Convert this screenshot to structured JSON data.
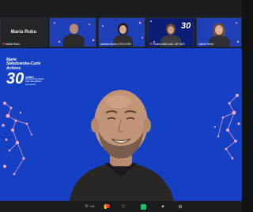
{
  "participants": [
    {
      "name": "Maria Rubu",
      "muted": true,
      "video": false
    },
    {
      "name": "",
      "muted": false,
      "video": true
    },
    {
      "name": "Adriana Bobu | GFCS.RO",
      "muted": false,
      "video": true
    },
    {
      "name": "Rodica Iulia Coin, GE SAS",
      "muted": true,
      "video": true
    },
    {
      "name": "Oana Ponea",
      "muted": false,
      "video": true
    }
  ],
  "main_speaker": {
    "name": ""
  },
  "branding": {
    "line1": "Marie",
    "line2": "Skłodowska-Curie",
    "line3": "Actions",
    "number": "30",
    "years": "years",
    "tagline1": "Connecting ideas",
    "tagline2": "that strengthen",
    "tagline3": "the world"
  },
  "toolbar": {
    "participants_count": "115",
    "icons": [
      "participants-icon",
      "reactions-icon",
      "chat-icon",
      "share-icon",
      "effects-icon",
      "more-icon"
    ]
  }
}
